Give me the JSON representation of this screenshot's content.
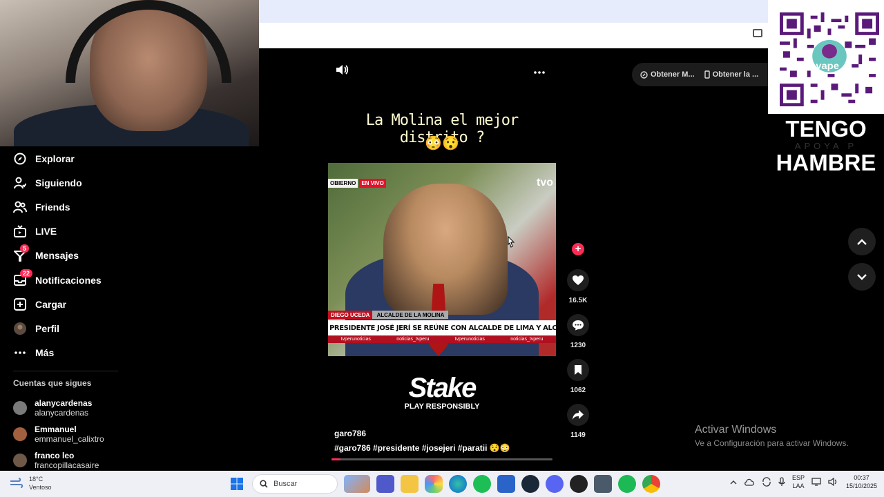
{
  "nav": {
    "items": [
      {
        "label": "Explorar",
        "icon": "compass-icon"
      },
      {
        "label": "Siguiendo",
        "icon": "person-follow-icon"
      },
      {
        "label": "Friends",
        "icon": "friends-icon"
      },
      {
        "label": "LIVE",
        "icon": "live-tv-icon"
      },
      {
        "label": "Mensajes",
        "icon": "message-icon",
        "badge": "5"
      },
      {
        "label": "Notificaciones",
        "icon": "inbox-icon",
        "badge": "22"
      },
      {
        "label": "Cargar",
        "icon": "upload-plus-icon"
      },
      {
        "label": "Perfil",
        "icon": "avatar-icon"
      },
      {
        "label": "Más",
        "icon": "ellipsis-icon"
      }
    ]
  },
  "following": {
    "title": "Cuentas que sigues",
    "accounts": [
      {
        "name": "alanycardenas",
        "handle": "alanycardenas"
      },
      {
        "name": "Emmanuel",
        "handle": "emmanuel_calixtro"
      },
      {
        "name": "franco leo",
        "handle": "francopillacasaire"
      }
    ]
  },
  "video": {
    "caption": "La Molina el mejor distrito ?",
    "caption_emoji": "😳😯",
    "channel_watermark": "tvo",
    "live_tag": [
      "OBIERNO",
      "EN VIVO"
    ],
    "lower_third_name": "DIEGO UCEDA",
    "lower_third_role": "ALCALDE DE LA MOLINA",
    "headline": "PRESIDENTE JOSÉ JERÍ SE REÚNE CON ALCALDE DE LIMA Y ALCALDES DISTRITALES",
    "socials": [
      "tvperunoticias",
      "noticias_tvperu",
      "tvperunoticias",
      "noticias_tvperu"
    ],
    "ad_logo": "Stake",
    "ad_tagline": "PLAY RESPONSIBLY",
    "author": "garo786",
    "hashtags": "#garo786  #presidente  #josejeri  #paratii  😯😳",
    "progress": 0.04
  },
  "actions": {
    "likes": "16.5K",
    "comments": "1230",
    "saves": "1062",
    "shares": "1149"
  },
  "top_pills": [
    "Obtener M...",
    "Obtener la ..."
  ],
  "overlay": {
    "tengo": "TENGO",
    "apoya": "APOYA P",
    "hambre": "HAMBRE",
    "qr_brand": "yape"
  },
  "watermark": {
    "line1": "Activar Windows",
    "line2": "Ve a Configuración para activar Windows."
  },
  "taskbar": {
    "temp": "18°C",
    "weather": "Ventoso",
    "search_placeholder": "Buscar",
    "lang1": "ESP",
    "lang2": "LAA",
    "time": "00:37",
    "date": "15/10/2025"
  },
  "colors": {
    "accent": "#fe2c55",
    "caption": "#fffbd0"
  }
}
